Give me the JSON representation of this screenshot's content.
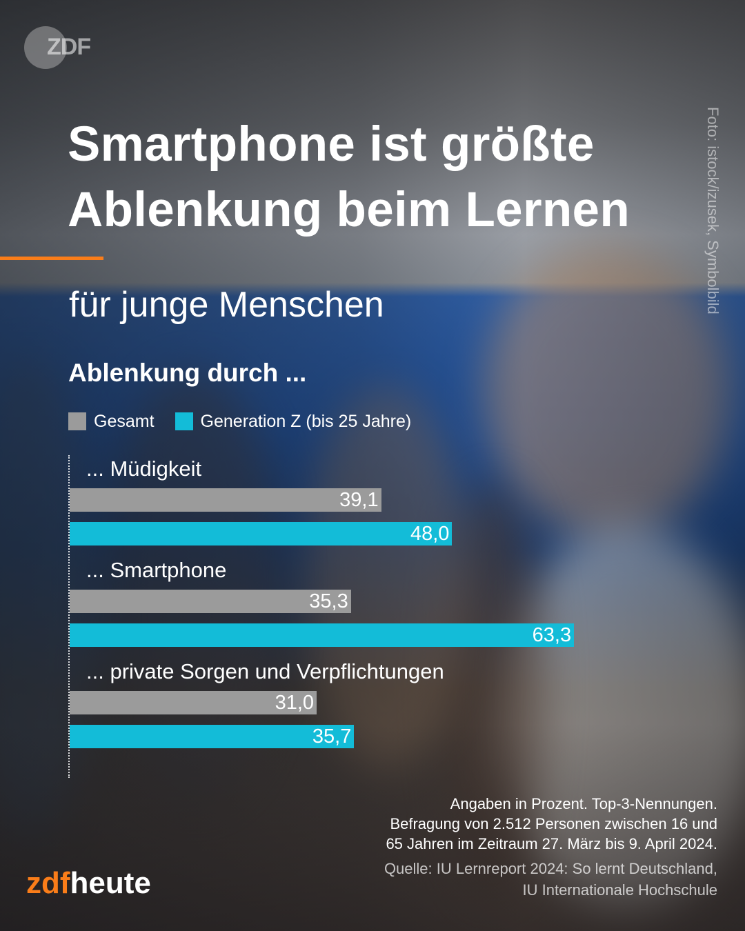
{
  "header": {
    "logo_text": "ZDF",
    "title_line1": "Smartphone ist größte",
    "title_line2": "Ablenkung beim Lernen",
    "subtitle": "für junge Menschen",
    "photo_credit": "Foto: istock/izusek, Symbolbild"
  },
  "chart_data": {
    "type": "bar",
    "orientation": "horizontal",
    "title": "Ablenkung durch ...",
    "categories": [
      "... Müdigkeit",
      "... Smartphone",
      "... private Sorgen und Verpflichtungen"
    ],
    "series": [
      {
        "name": "Gesamt",
        "color": "#9b9b9b",
        "values": [
          39.1,
          35.3,
          31.0
        ],
        "labels": [
          "39,1",
          "35,3",
          "31,0"
        ]
      },
      {
        "name": "Generation Z (bis 25 Jahre)",
        "color": "#13bcd8",
        "values": [
          48.0,
          63.3,
          35.7
        ],
        "labels": [
          "48,0",
          "63,3",
          "35,7"
        ]
      }
    ],
    "unit": "Prozent",
    "legend_position": "top-left",
    "grid": false
  },
  "footer": {
    "notes": [
      "Angaben in Prozent. Top-3-Nennungen.",
      "Befragung von 2.512 Personen zwischen 16 und",
      "65 Jahren im Zeitraum 27. März bis 9. April 2024."
    ],
    "source": [
      "Quelle: IU Lernreport 2024: So lernt Deutschland,",
      "IU Internationale Hochschule"
    ],
    "brand_zdf": "zdf",
    "brand_heute": "heute"
  },
  "colors": {
    "accent": "#fa7d19",
    "gesamt": "#9b9b9b",
    "gen_z": "#13bcd8"
  }
}
